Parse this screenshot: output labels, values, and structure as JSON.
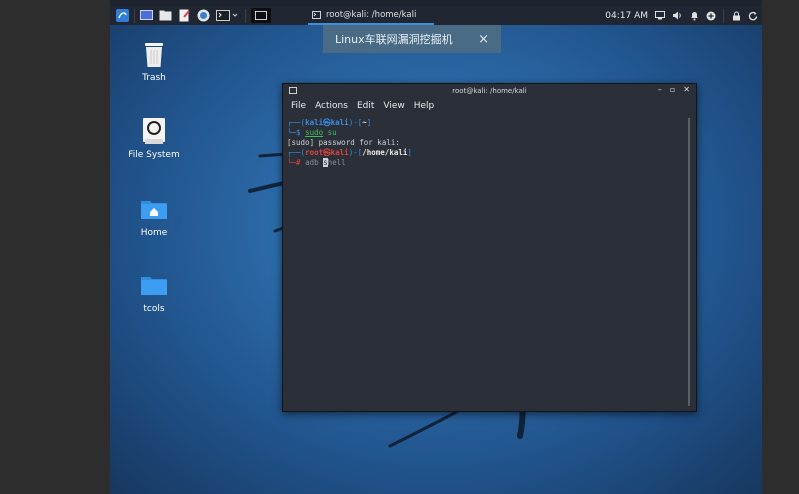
{
  "taskbar": {
    "task_label": "root@kali: /home/kali",
    "clock": "04:17 AM",
    "launchers": [
      "kali-menu-icon",
      "desktop-icon",
      "file-manager-icon",
      "text-editor-icon",
      "browser-icon",
      "terminal-icon"
    ]
  },
  "notification": {
    "text": "Linux车联网漏洞挖掘机",
    "close": "×"
  },
  "desktop": {
    "icons": [
      {
        "label": "Trash"
      },
      {
        "label": "File System"
      },
      {
        "label": "Home"
      },
      {
        "label": "tcols"
      }
    ]
  },
  "terminal": {
    "title": "root@kali: /home/kali",
    "menu": [
      "File",
      "Actions",
      "Edit",
      "View",
      "Help"
    ],
    "lines": {
      "l1_a": "┌──(",
      "l1_user": "kali㉿kali",
      "l1_b": ")-[",
      "l1_dir": "~",
      "l1_c": "]",
      "l2_a": "└─$ ",
      "l2_cmd": "sudo",
      "l2_arg": " su",
      "l3": "[sudo] password for kali:",
      "l4_a": "┌──(",
      "l4_user": "root㉿kali",
      "l4_b": ")-[",
      "l4_dir": "/home/kali",
      "l4_c": "]",
      "l5_a": "└─# ",
      "l5_cmd": "adb ",
      "l5_cursor": "s",
      "l5_rest": "hell"
    }
  }
}
